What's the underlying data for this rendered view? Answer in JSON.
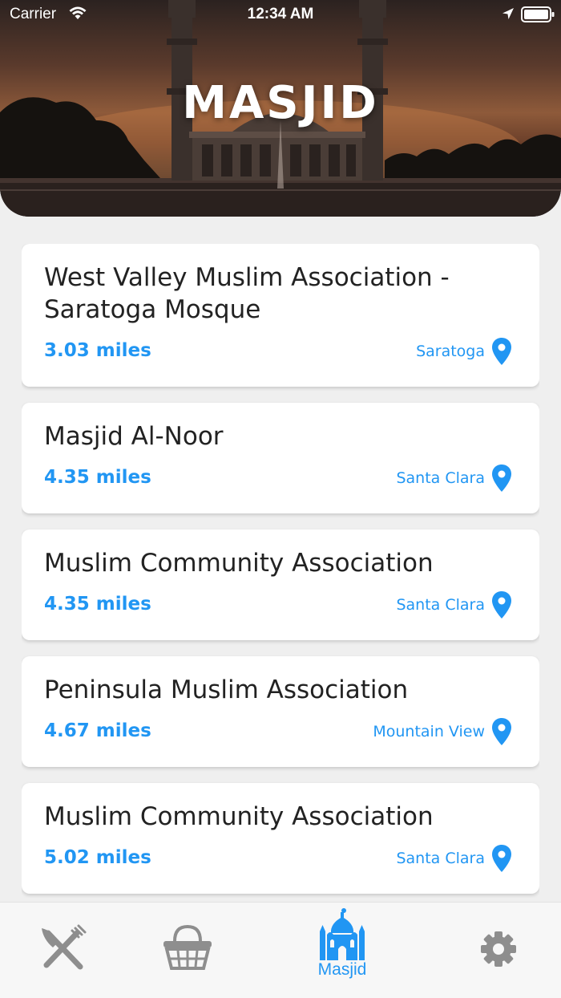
{
  "status_bar": {
    "carrier": "Carrier",
    "time": "12:34 AM"
  },
  "header": {
    "title": "MASJID"
  },
  "masjids": [
    {
      "name": "West Valley Muslim Association - Saratoga Mosque",
      "distance": "3.03 miles",
      "city": "Saratoga"
    },
    {
      "name": "Masjid Al-Noor",
      "distance": "4.35 miles",
      "city": "Santa Clara"
    },
    {
      "name": "Muslim Community Association",
      "distance": "4.35 miles",
      "city": "Santa Clara"
    },
    {
      "name": "Peninsula Muslim Association",
      "distance": "4.67 miles",
      "city": "Mountain View"
    },
    {
      "name": "Muslim Community Association",
      "distance": "5.02 miles",
      "city": "Santa Clara"
    }
  ],
  "bottom_nav": {
    "items": [
      {
        "icon": "fork-knife-icon",
        "label": ""
      },
      {
        "icon": "basket-icon",
        "label": ""
      },
      {
        "icon": "mosque-icon",
        "label": "Masjid"
      },
      {
        "icon": "gear-icon",
        "label": ""
      }
    ],
    "active_color": "#2196f3",
    "inactive_color": "#8e8e8e"
  },
  "colors": {
    "accent": "#2196f3",
    "background": "#efefef",
    "card": "#ffffff"
  }
}
